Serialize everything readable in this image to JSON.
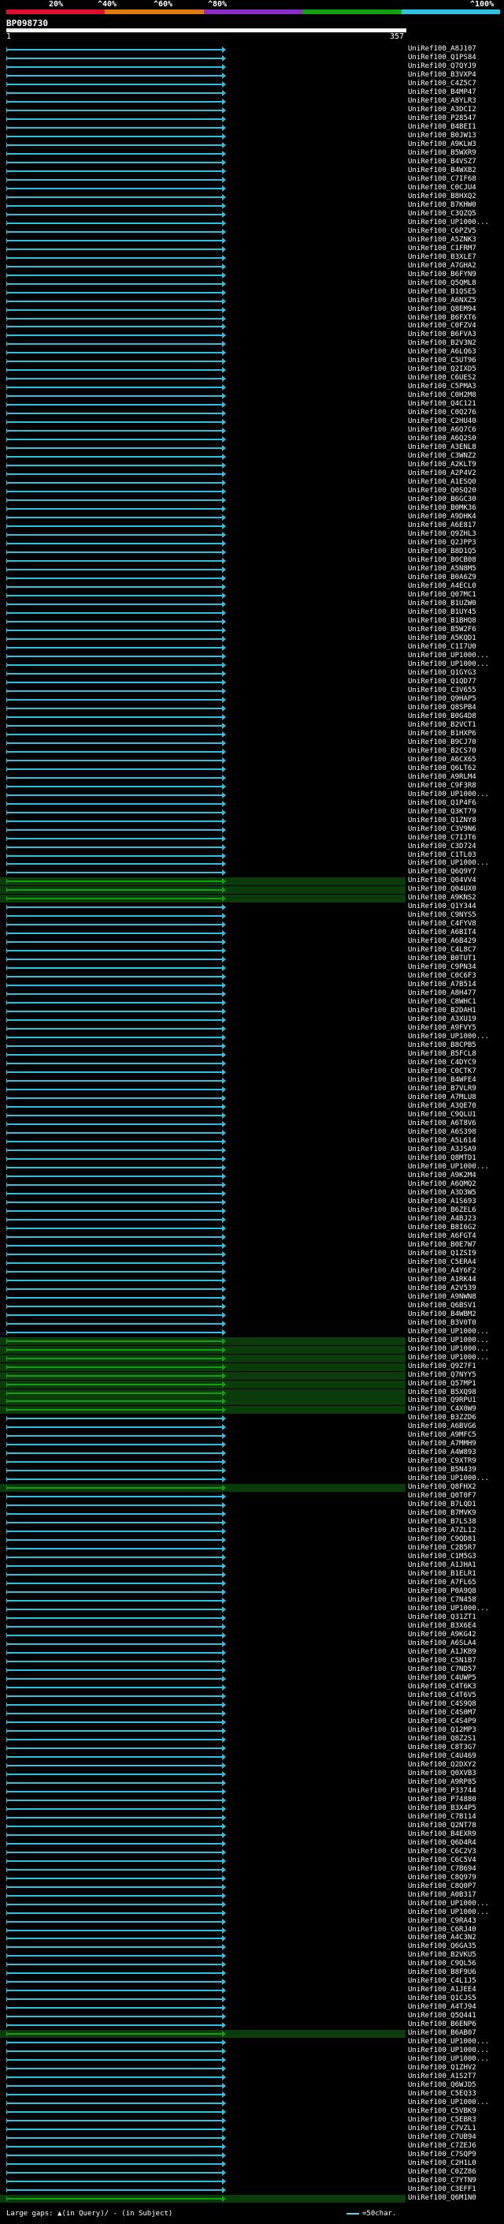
{
  "header": {
    "percent_labels": [
      "20%",
      "^40%",
      "^60%",
      "^80%",
      "^100%"
    ],
    "colors": [
      "#e0102c",
      "#e07a10",
      "#8a2cc8",
      "#10a010",
      "#30c0e0"
    ]
  },
  "query": {
    "title": "BP098730",
    "start": "1",
    "end": "357"
  },
  "footer": {
    "large_gaps": "Large gaps: ▲(in Query)/ - (in Subject)",
    "scale": "=50char."
  },
  "hits": [
    "UniRef100_A8J107",
    "UniRef100_Q1PS84",
    "UniRef100_Q7QYJ9",
    "UniRef100_B3VXP4",
    "UniRef100_C4Z5C7",
    "UniRef100_B4MP47",
    "UniRef100_A8YLR3",
    "UniRef100_A3DCI2",
    "UniRef100_P28547",
    "UniRef100_B4BEI1",
    "UniRef100_B0JW13",
    "UniRef100_A9KLW3",
    "UniRef100_B5WXR9",
    "UniRef100_B4VSZ7",
    "UniRef100_B4WXB2",
    "UniRef100_C7IF68",
    "UniRef100_C0CJU4",
    "UniRef100_B8HXQ2",
    "UniRef100_B7KHW0",
    "UniRef100_C3QZQ5",
    "UniRef100_UP1000...",
    "UniRef100_C6PZV5",
    "UniRef100_A5ZNK3",
    "UniRef100_C1FRM7",
    "UniRef100_B3XLE7",
    "UniRef100_A7GHA2",
    "UniRef100_B6FYN9",
    "UniRef100_Q5QML8",
    "UniRef100_B1QSE5",
    "UniRef100_A6NXZ5",
    "UniRef100_Q8EM94",
    "UniRef100_B6FXT6",
    "UniRef100_C0FZV4",
    "UniRef100_B6FVA3",
    "UniRef100_B2V3N2",
    "UniRef100_A6LQ63",
    "UniRef100_C5UT96",
    "UniRef100_Q2IXD5",
    "UniRef100_C6UES2",
    "UniRef100_C5PMA3",
    "UniRef100_C0H2M8",
    "UniRef100_Q4C121",
    "UniRef100_C0Q276",
    "UniRef100_C2HU40",
    "UniRef100_A6Q7C6",
    "UniRef100_A6Q2S0",
    "UniRef100_A3ENL8",
    "UniRef100_C3WNZ2",
    "UniRef100_A2KLT9",
    "UniRef100_A2P4V2",
    "UniRef100_A1ESQ0",
    "UniRef100_Q0SQ20",
    "UniRef100_B6GC30",
    "UniRef100_B0MK36",
    "UniRef100_A9DHK4",
    "UniRef100_A6E817",
    "UniRef100_Q9ZHL3",
    "UniRef100_Q2JPP3",
    "UniRef100_B8D1Q5",
    "UniRef100_B0CB08",
    "UniRef100_A5N8M5",
    "UniRef100_B0A6Z9",
    "UniRef100_A4ECL0",
    "UniRef100_Q07MC1",
    "UniRef100_B1UZW0",
    "UniRef100_B1UY45",
    "UniRef100_B1BHQ8",
    "UniRef100_B5W2F6",
    "UniRef100_A5KQD1",
    "UniRef100_C1I7U0",
    "UniRef100_UP1000...",
    "UniRef100_UP1000...",
    "UniRef100_Q1GYG3",
    "UniRef100_Q1QD77",
    "UniRef100_C3V655",
    "UniRef100_Q9HAP5",
    "UniRef100_Q8SPB4",
    "UniRef100_B0G4D8",
    "UniRef100_B2VCT1",
    "UniRef100_B1HXP6",
    "UniRef100_B9CJ70",
    "UniRef100_B2CS70",
    "UniRef100_A6CX65",
    "UniRef100_Q6LT62",
    "UniRef100_A9RLM4",
    "UniRef100_C9F3R8",
    "UniRef100_UP1000...",
    "UniRef100_Q1P4F6",
    "UniRef100_Q3KT79",
    "UniRef100_Q1ZNY8",
    "UniRef100_C3V9N6",
    "UniRef100_C7IJT6",
    "UniRef100_C3D724",
    "UniRef100_C1TL03",
    "UniRef100_UP1000...",
    "UniRef100_Q6Q9Y7",
    "UniRef100_Q04VV4",
    "UniRef100_Q04UX0",
    "UniRef100_A9KNS2",
    "UniRef100_Q1Y344",
    "UniRef100_C9NYS5",
    "UniRef100_C4FYV8",
    "UniRef100_A6BIT4",
    "UniRef100_A6B429",
    "UniRef100_C4L8C7",
    "UniRef100_B0TUT1",
    "UniRef100_C9PN34",
    "UniRef100_C0C6F3",
    "UniRef100_A7B514",
    "UniRef100_A8H477",
    "UniRef100_C8WHC1",
    "UniRef100_B2DAH1",
    "UniRef100_A3XU19",
    "UniRef100_A9FVY5",
    "UniRef100_UP1000...",
    "UniRef100_B8CPB5",
    "UniRef100_B5FCL8",
    "UniRef100_C4DYC9",
    "UniRef100_C0CTK7",
    "UniRef100_B4WFE4",
    "UniRef100_B7VLR9",
    "UniRef100_A7MLU8",
    "UniRef100_A3QE70",
    "UniRef100_C9QLU1",
    "UniRef100_A6T8V6",
    "UniRef100_A6S398",
    "UniRef100_A5L614",
    "UniRef100_A3JSA9",
    "UniRef100_Q8MTD1",
    "UniRef100_UP1000...",
    "UniRef100_A9K2M4",
    "UniRef100_A6QMQ2",
    "UniRef100_A3D3W5",
    "UniRef100_A1S693",
    "UniRef100_B6ZEL6",
    "UniRef100_A4BJ23",
    "UniRef100_B8I6G2",
    "UniRef100_A6FGT4",
    "UniRef100_B0E7W7",
    "UniRef100_Q1ZSI9",
    "UniRef100_C5ERA4",
    "UniRef100_A4Y6F2",
    "UniRef100_A1RK44",
    "UniRef100_A2V539",
    "UniRef100_A9NWN8",
    "UniRef100_Q6BSV1",
    "UniRef100_B4WBM2",
    "UniRef100_B3V0T0",
    "UniRef100_UP1000...",
    "UniRef100_UP1000...",
    "UniRef100_UP1000...",
    "UniRef100_UP1000...",
    "UniRef100_Q9Z7F1",
    "UniRef100_Q7NYY5",
    "UniRef100_Q57MP1",
    "UniRef100_B5XQ98",
    "UniRef100_Q9RPU1",
    "UniRef100_C4X0W9",
    "UniRef100_B3ZZD6",
    "UniRef100_A6BVG6",
    "UniRef100_A9MFC5",
    "UniRef100_A7MMH9",
    "UniRef100_A4W893",
    "UniRef100_C9XTR9",
    "UniRef100_B5N439",
    "UniRef100_UP1000...",
    "UniRef100_Q8FHX2",
    "UniRef100_Q0T0F7",
    "UniRef100_B7LQD1",
    "UniRef100_B7MVK9",
    "UniRef100_B7LS38",
    "UniRef100_A7ZL12",
    "UniRef100_C9QD81",
    "UniRef100_C2B5R7",
    "UniRef100_C1M5G3",
    "UniRef100_A1JHA1",
    "UniRef100_B1ELR1",
    "UniRef100_A7FL65",
    "UniRef100_P0A9Q8",
    "UniRef100_C7N458",
    "UniRef100_UP1000...",
    "UniRef100_Q31ZT1",
    "UniRef100_B3X6E4",
    "UniRef100_A9KG42",
    "UniRef100_A6SLA4",
    "UniRef100_A1JKB9",
    "UniRef100_C5N1B7",
    "UniRef100_C7ND57",
    "UniRef100_C4UWP5",
    "UniRef100_C4T6K3",
    "UniRef100_C4T6V5",
    "UniRef100_C4S9Q8",
    "UniRef100_C4S0M7",
    "UniRef100_C4S4P9",
    "UniRef100_Q12MP3",
    "UniRef100_Q8Z2S1",
    "UniRef100_C8T3G7",
    "UniRef100_C4U469",
    "UniRef100_Q2DXY2",
    "UniRef100_Q0XVB3",
    "UniRef100_A9RP85",
    "UniRef100_P33744",
    "UniRef100_P74880",
    "UniRef100_B3X4P5",
    "UniRef100_C7B114",
    "UniRef100_Q2NT78",
    "UniRef100_B4EXR9",
    "UniRef100_Q6D4R4",
    "UniRef100_C6C2V3",
    "UniRef100_C6C5V4",
    "UniRef100_C7B694",
    "UniRef100_C8Q979",
    "UniRef100_C8Q0P7",
    "UniRef100_A0B317",
    "UniRef100_UP1000...",
    "UniRef100_UP1000...",
    "UniRef100_C9RA43",
    "UniRef100_C6RJ40",
    "UniRef100_A4C3N2",
    "UniRef100_Q6GA35",
    "UniRef100_B2VKU5",
    "UniRef100_C9QL56",
    "UniRef100_B8F9U6",
    "UniRef100_C4L1J5",
    "UniRef100_A1JEE4",
    "UniRef100_Q1CJS5",
    "UniRef100_A4TJ94",
    "UniRef100_Q5Q441",
    "UniRef100_B6ENP6",
    "UniRef100_B6AB07",
    "UniRef100_UP1000...",
    "UniRef100_UP1000...",
    "UniRef100_UP1000...",
    "UniRef100_Q1ZHV2",
    "UniRef100_A1S2T7",
    "UniRef100_Q6WJD5",
    "UniRef100_C5EQ33",
    "UniRef100_UP1000...",
    "UniRef100_C5VBK9",
    "UniRef100_C5EBR3",
    "UniRef100_C7VZL1",
    "UniRef100_C7UB94",
    "UniRef100_C7ZEJ6",
    "UniRef100_C7SQP9",
    "UniRef100_C2H1L0",
    "UniRef100_C0ZZ86",
    "UniRef100_C7YTN9",
    "UniRef100_C3EFF1",
    "UniRef100_Q6M1N0"
  ]
}
